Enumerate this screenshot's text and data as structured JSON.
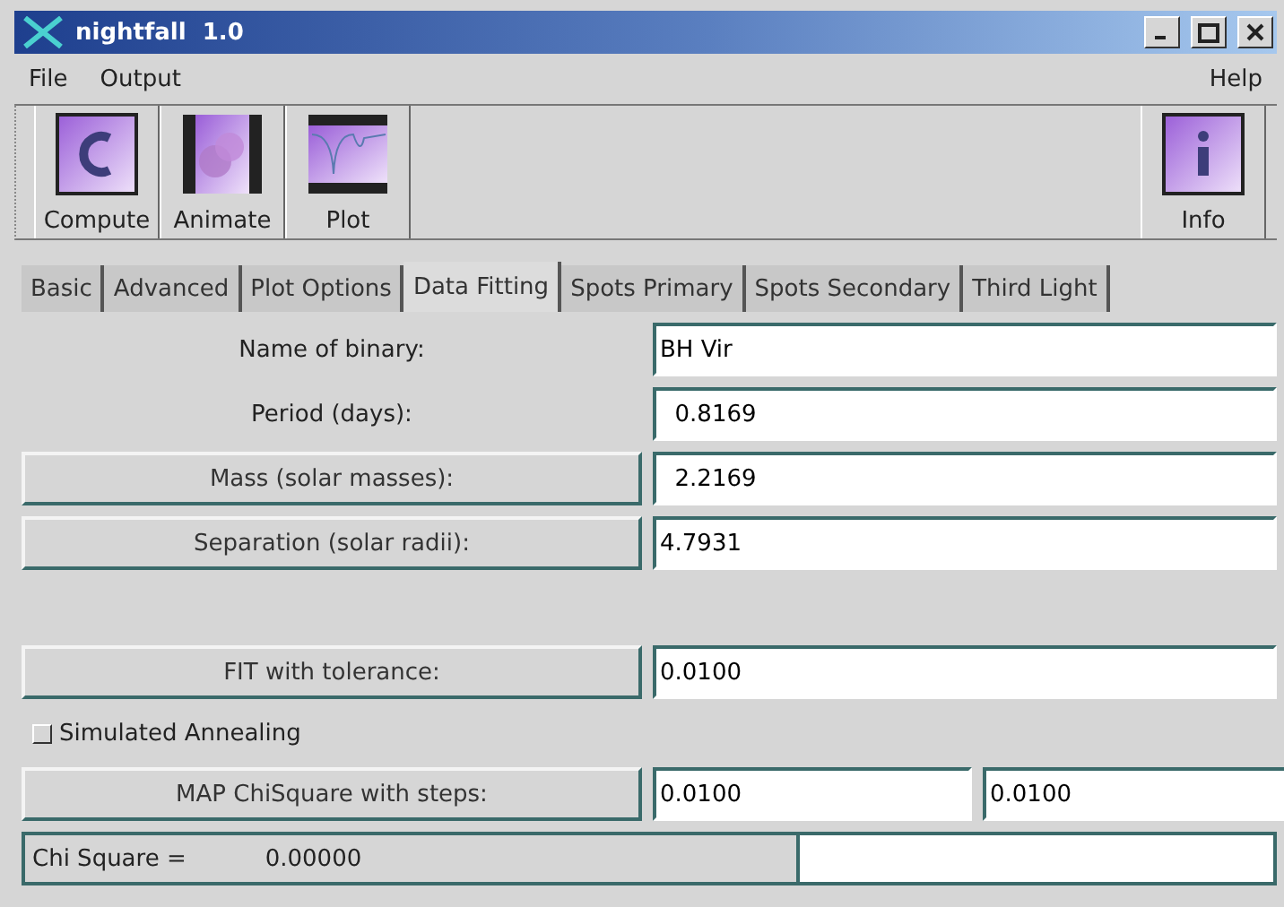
{
  "window": {
    "title": "nightfall  1.0"
  },
  "menu": {
    "left": [
      "File",
      "Output"
    ],
    "right": [
      "Help"
    ]
  },
  "toolbar": {
    "left": [
      {
        "label": "Compute",
        "kind": "compute"
      },
      {
        "label": "Animate",
        "kind": "animate"
      },
      {
        "label": "Plot",
        "kind": "plot"
      }
    ],
    "right": [
      {
        "label": "Info",
        "kind": "info"
      }
    ]
  },
  "tabs": [
    {
      "label": "Basic",
      "selected": false
    },
    {
      "label": "Advanced",
      "selected": false
    },
    {
      "label": "Plot Options",
      "selected": false
    },
    {
      "label": "Data Fitting",
      "selected": true
    },
    {
      "label": "Spots Primary",
      "selected": false
    },
    {
      "label": "Spots Secondary",
      "selected": false
    },
    {
      "label": "Third Light",
      "selected": false
    }
  ],
  "rows": [
    {
      "kind": "label",
      "label": "Name of binary:",
      "values": [
        "BH Vir"
      ]
    },
    {
      "kind": "label",
      "label": "Period (days):",
      "values": [
        "  0.8169"
      ]
    },
    {
      "kind": "button",
      "label": "Mass (solar masses):",
      "values": [
        "  2.2169"
      ]
    },
    {
      "kind": "button",
      "label": "Separation (solar radii):",
      "values": [
        "4.7931"
      ]
    },
    {
      "kind": "spacer"
    },
    {
      "kind": "button",
      "label": "FIT with tolerance:",
      "values": [
        "0.0100"
      ]
    },
    {
      "kind": "checkbox",
      "label": "Simulated Annealing",
      "checked": false
    },
    {
      "kind": "button",
      "label": "MAP ChiSquare with steps:",
      "values": [
        "0.0100",
        "0.0100"
      ]
    }
  ],
  "status_bar": {
    "label": "Chi Square =",
    "value": "0.00000"
  }
}
